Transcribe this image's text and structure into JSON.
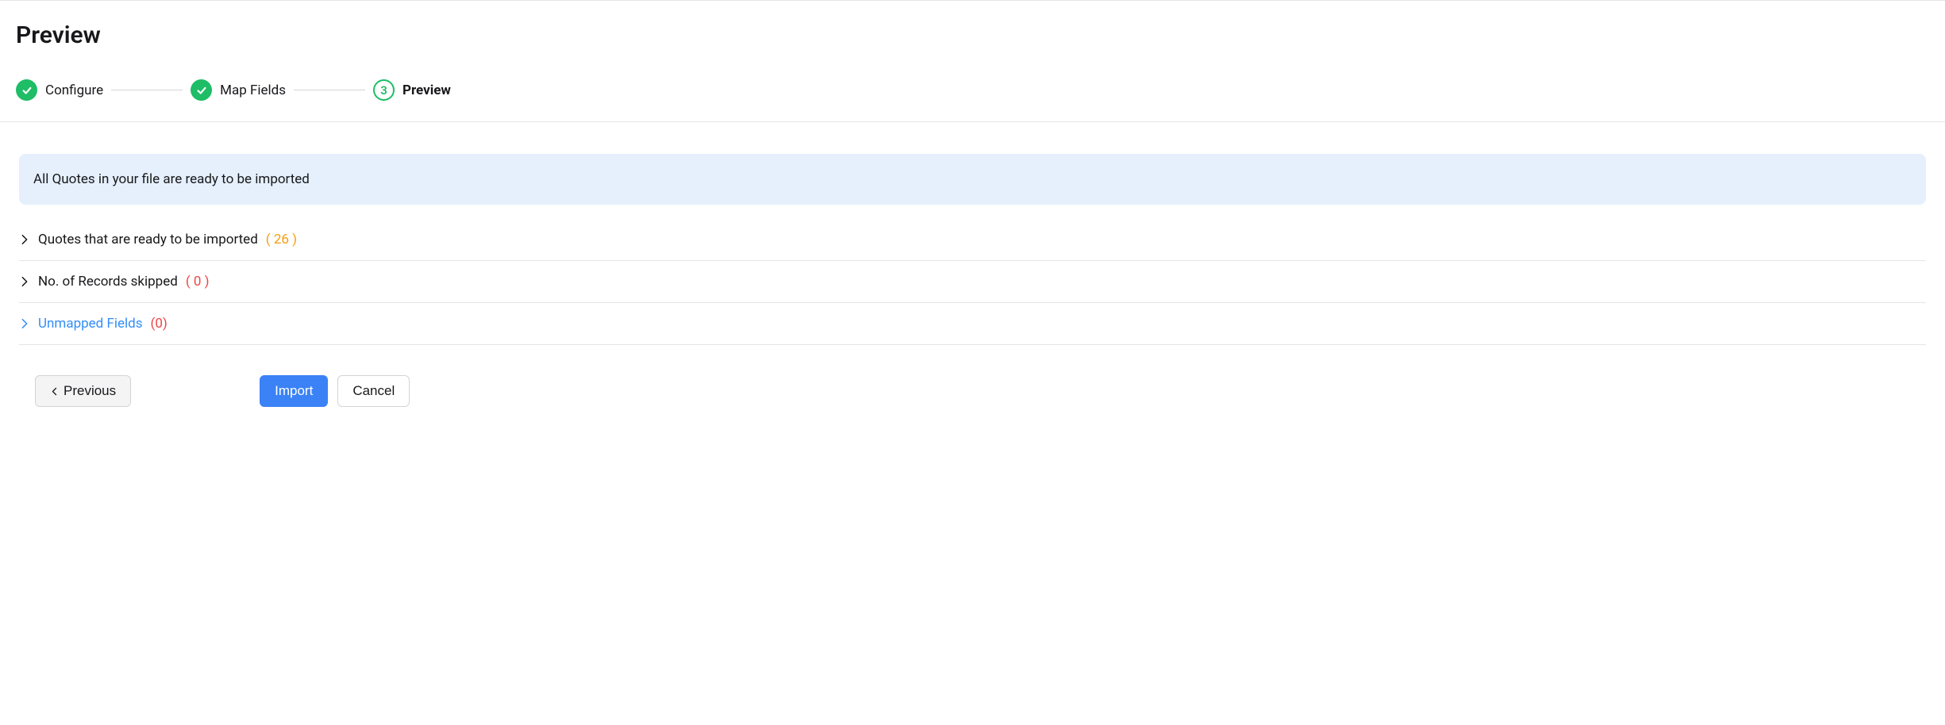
{
  "page": {
    "title": "Preview"
  },
  "stepper": {
    "steps": [
      {
        "label": "Configure",
        "state": "done"
      },
      {
        "label": "Map Fields",
        "state": "done"
      },
      {
        "label": "Preview",
        "state": "current",
        "number": "3"
      }
    ]
  },
  "banner": {
    "text": "All Quotes in your file are ready to be imported"
  },
  "summary": {
    "rows": [
      {
        "label": "Quotes that are ready to be imported",
        "count": "( 26 )",
        "countColor": "orange",
        "link": false
      },
      {
        "label": "No. of Records skipped",
        "count": "( 0 )",
        "countColor": "red",
        "link": false
      },
      {
        "label": "Unmapped Fields",
        "count": "(0)",
        "countColor": "red",
        "link": true
      }
    ]
  },
  "actions": {
    "previous": "Previous",
    "import": "Import",
    "cancel": "Cancel"
  }
}
